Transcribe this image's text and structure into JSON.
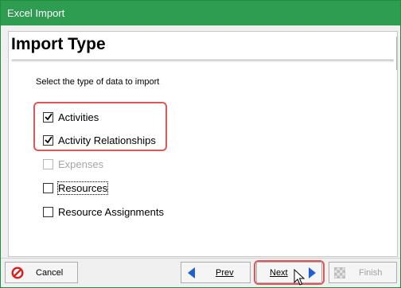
{
  "window": {
    "title": "Excel Import"
  },
  "page": {
    "title": "Import Type",
    "instruction": "Select the type of data to import"
  },
  "options": [
    {
      "label": "Activities",
      "checked": true,
      "enabled": true
    },
    {
      "label": "Activity Relationships",
      "checked": true,
      "enabled": true
    },
    {
      "label": "Expenses",
      "checked": false,
      "enabled": false
    },
    {
      "label": "Resources",
      "checked": false,
      "enabled": true,
      "focused": true
    },
    {
      "label": "Resource Assignments",
      "checked": false,
      "enabled": true
    }
  ],
  "buttons": {
    "cancel": "Cancel",
    "prev": "Prev",
    "next": "Next",
    "finish": "Finish"
  },
  "colors": {
    "titlebar": "#2e9d52",
    "highlight": "#e05555",
    "nav_arrow": "#1f5fd6",
    "cancel_icon": "#d42020"
  }
}
